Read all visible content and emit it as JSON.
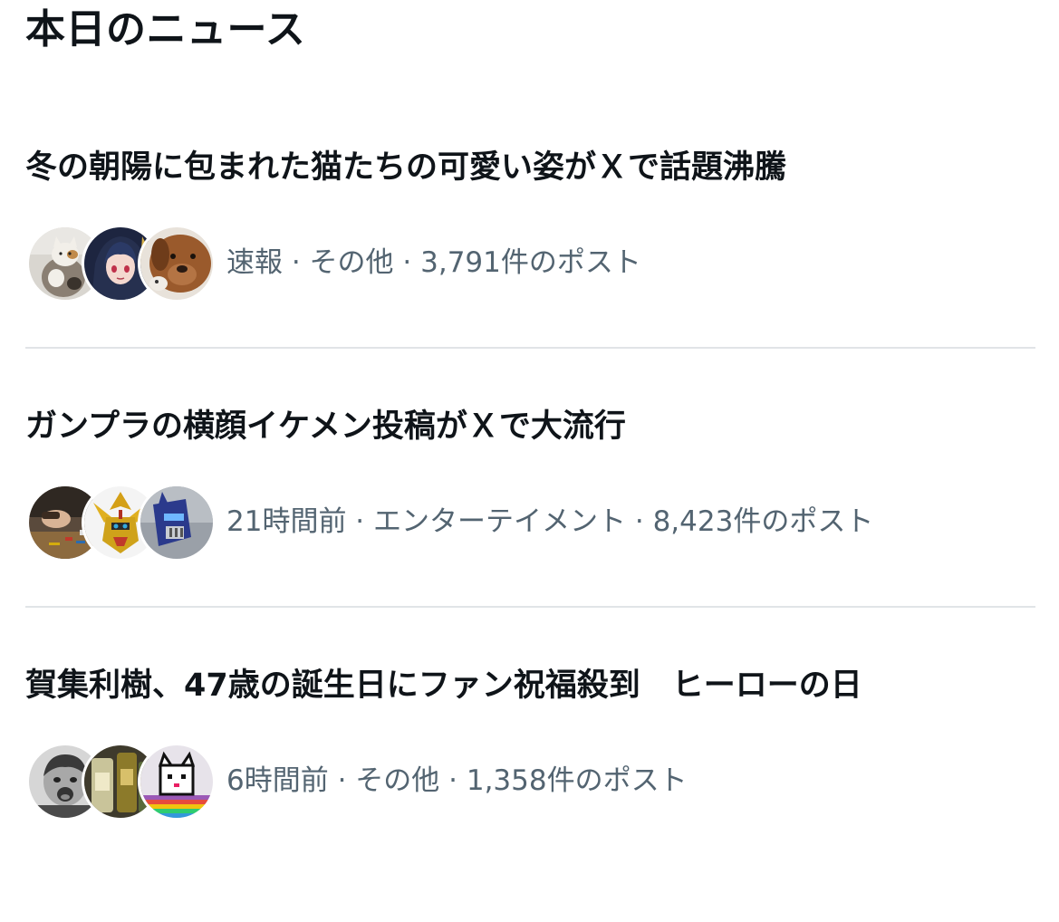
{
  "section": {
    "title": "本日のニュース"
  },
  "news": [
    {
      "headline": "冬の朝陽に包まれた猫たちの可愛い姿がＸで話題沸騰",
      "meta": "速報 · その他 · 3,791件のポスト",
      "avatar_icons": [
        "cat-photo-avatar-icon",
        "anime-character-avatar-icon",
        "dog-photo-avatar-icon"
      ]
    },
    {
      "headline": "ガンプラの横顔イケメン投稿がＸで大流行",
      "meta": "21時間前 · エンターテイメント · 8,423件のポスト",
      "avatar_icons": [
        "model-building-avatar-icon",
        "gold-robot-avatar-icon",
        "blue-robot-avatar-icon"
      ]
    },
    {
      "headline": "賀集利樹、47歳の誕生日にファン祝福殺到　ヒーローの日",
      "meta": "6時間前 · その他 · 1,358件のポスト",
      "avatar_icons": [
        "child-photo-avatar-icon",
        "bottles-avatar-icon",
        "pixel-cat-avatar-icon"
      ]
    }
  ],
  "colors": {
    "text_primary": "#0f1419",
    "text_secondary": "#536471",
    "divider": "#e1e4e7",
    "background": "#ffffff"
  }
}
